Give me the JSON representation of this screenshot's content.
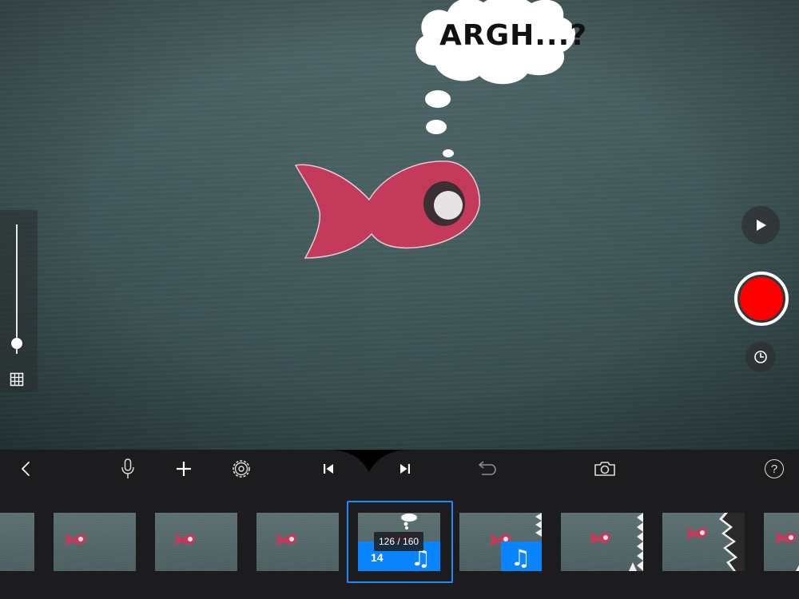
{
  "scene": {
    "speech_bubble_text": "ARGH...?",
    "subject": "red paper fish"
  },
  "camera_controls": {
    "zoom_level": 0.08,
    "play_icon": "play-icon",
    "record_icon": "record-icon",
    "timer_icon": "clock-icon",
    "grid_icon": "grid-icon"
  },
  "toolbar": {
    "items": [
      {
        "name": "back-button",
        "icon": "chevron-left-icon"
      },
      {
        "name": "microphone-button",
        "icon": "microphone-icon"
      },
      {
        "name": "add-button",
        "icon": "plus-icon"
      },
      {
        "name": "settings-button",
        "icon": "gear-icon"
      },
      {
        "name": "first-frame-button",
        "icon": "skip-back-icon"
      },
      {
        "name": "last-frame-button",
        "icon": "skip-forward-icon"
      },
      {
        "name": "undo-button",
        "icon": "undo-icon"
      },
      {
        "name": "camera-button",
        "icon": "camera-icon"
      },
      {
        "name": "help-button",
        "icon": "help-icon"
      }
    ],
    "help_label": "?"
  },
  "filmstrip": {
    "selected_frame_number": "14",
    "frame_counter": "126 / 160",
    "music_glyph": "♫",
    "accent_color": "#0a84ff",
    "record_color": "#ff0000"
  }
}
